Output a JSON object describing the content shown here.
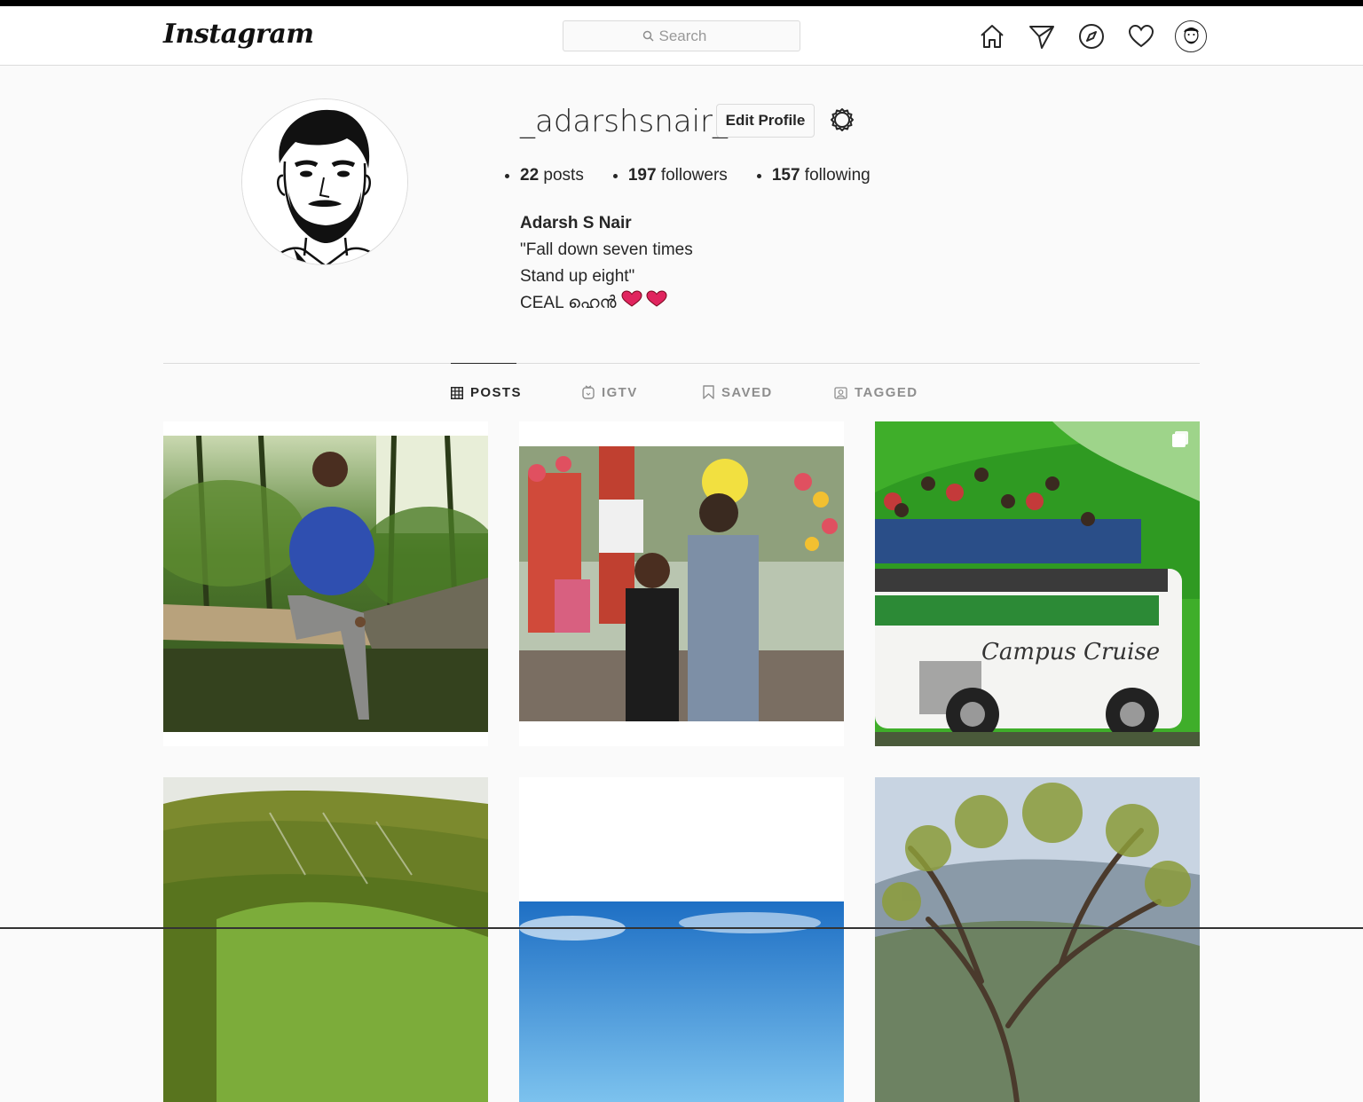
{
  "nav": {
    "logo": "Instagram",
    "search_placeholder": "Search",
    "icons": [
      "home-icon",
      "direct-icon",
      "explore-icon",
      "activity-heart-icon",
      "profile-avatar"
    ]
  },
  "profile": {
    "username": "_adarshsnair_",
    "edit_button": "Edit Profile",
    "stats": {
      "posts_count": "22",
      "posts_label": "posts",
      "followers_count": "197",
      "followers_label": "followers",
      "following_count": "157",
      "following_label": "following"
    },
    "full_name": "Adarsh S Nair",
    "bio_lines": [
      "\"Fall down seven times",
      "Stand up eight\"",
      "CEAL ഹെൻ"
    ],
    "bio_emoji": "❤️❤️"
  },
  "tabs": [
    {
      "label": "POSTS",
      "icon": "grid-icon",
      "active": true
    },
    {
      "label": "IGTV",
      "icon": "igtv-icon",
      "active": false
    },
    {
      "label": "SAVED",
      "icon": "bookmark-icon",
      "active": false
    },
    {
      "label": "TAGGED",
      "icon": "tagged-icon",
      "active": false
    }
  ],
  "posts": [
    {
      "description": "man sitting on log in forest"
    },
    {
      "description": "two men at flower show entrance"
    },
    {
      "description": "group on top of campus bus",
      "multiple": true
    },
    {
      "description": "green hills landscape"
    },
    {
      "description": "blue sky panorama"
    },
    {
      "description": "tree branches over hills"
    }
  ],
  "colors": {
    "background": "#fafafa",
    "border": "#dbdbdb",
    "text": "#262626",
    "muted": "#8e8e8e",
    "heart": "#e0245e"
  }
}
